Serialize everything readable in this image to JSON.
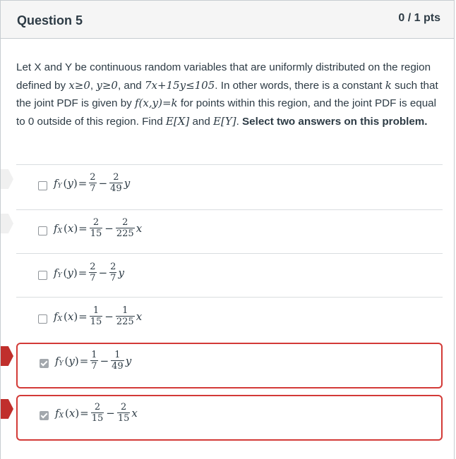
{
  "question": {
    "title": "Question 5",
    "points": "0 / 1 pts"
  },
  "prompt": {
    "p1": "Let X and Y be continuous random variables that are uniformly distributed on the region defined by ",
    "cond1": "x≥0",
    "comma1": ", ",
    "cond2": "y≥0",
    "and1": ", and ",
    "cond3": "7x+15y≤105",
    "p2": ". In other words, there is a constant ",
    "k": "k",
    "p3": " such that the joint PDF is given by ",
    "fxy": "f(x,y)=k",
    "p4": " for points within this region, and the joint PDF is equal to 0 outside of this region. Find ",
    "ex": "E[X]",
    "and2": " and ",
    "ey": "E[Y]",
    "p5": ". ",
    "bold": "Select two answers on this problem."
  },
  "answers": [
    {
      "func": "f",
      "sub": "Y",
      "var": "y",
      "n1": "2",
      "d1": "7",
      "n2": "2",
      "d2": "49",
      "checked": false,
      "wrong": false
    },
    {
      "func": "f",
      "sub": "X",
      "var": "x",
      "n1": "2",
      "d1": "15",
      "n2": "2",
      "d2": "225",
      "checked": false,
      "wrong": false
    },
    {
      "func": "f",
      "sub": "Y",
      "var": "y",
      "n1": "2",
      "d1": "7",
      "n2": "2",
      "d2": "7",
      "checked": false,
      "wrong": false
    },
    {
      "func": "f",
      "sub": "X",
      "var": "x",
      "n1": "1",
      "d1": "15",
      "n2": "1",
      "d2": "225",
      "checked": false,
      "wrong": false
    },
    {
      "func": "f",
      "sub": "Y",
      "var": "y",
      "n1": "1",
      "d1": "7",
      "n2": "1",
      "d2": "49",
      "checked": true,
      "wrong": true
    },
    {
      "func": "f",
      "sub": "X",
      "var": "x",
      "n1": "2",
      "d1": "15",
      "n2": "2",
      "d2": "15",
      "checked": true,
      "wrong": true
    }
  ],
  "colors": {
    "wrong_border": "#d33a37",
    "wrong_notch": "#c02f2c",
    "header_bg": "#f5f5f5"
  }
}
